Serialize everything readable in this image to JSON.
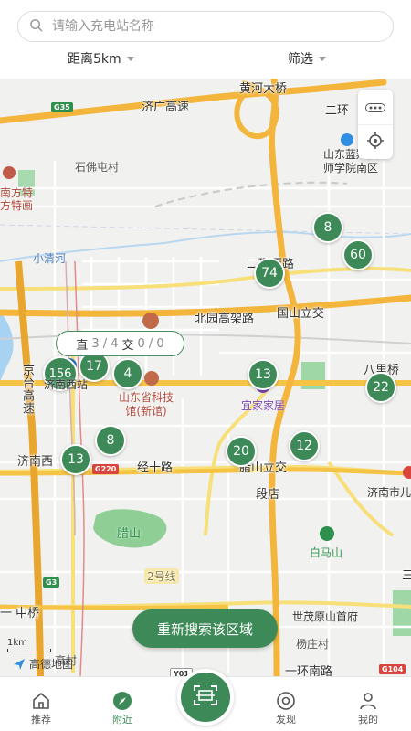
{
  "search": {
    "placeholder": "请输入充电站名称"
  },
  "filters": {
    "distance_label": "距离5km",
    "filter_label": "筛选"
  },
  "map": {
    "road_labels": {
      "jiguang": "济广高速",
      "huanghe_bridge": "黄河大桥",
      "erhuan_xilu": "二环西路",
      "beiyuan": "北园高架路",
      "guoshan_lijiao": "国山立交",
      "jingshi_road": "经十路",
      "lashan_lijiao": "腊山立交",
      "duandian": "段店",
      "jingtai": "京台高速",
      "yihuannan": "一环南路",
      "zhongqiao": "一 中桥",
      "erhuan_fragment": "二环",
      "jinan_west": "济南西",
      "sanshou": "三"
    },
    "shields": {
      "g35": "G35",
      "g220": "G220",
      "g3": "G3",
      "g104": "G104",
      "y01": "Y01",
      "line2": "2号线"
    },
    "pois": {
      "lanxiang": "山东蓝翔技\n师学院南区",
      "shifo": "石佛屯村",
      "nanfang": "南方特\n方特画",
      "xiaoqinghe": "小清河",
      "science_museum": "山东省科技\n馆(新馆)",
      "yijia": "宜家家居",
      "balqiao": "八里桥",
      "lashan": "腊山",
      "baimashan": "白马山",
      "jinan_city": "济南市儿",
      "shimao": "世茂原山首府",
      "yangzhuang": "杨庄村",
      "xi_station": "济南西站",
      "gaocun": "高村"
    },
    "markers": [
      {
        "count": "8"
      },
      {
        "count": "60"
      },
      {
        "count": "74"
      },
      {
        "count": "156"
      },
      {
        "count": "17"
      },
      {
        "count": "4"
      },
      {
        "count": "13"
      },
      {
        "count": "22"
      },
      {
        "count": "8"
      },
      {
        "count": "13"
      },
      {
        "count": "20"
      },
      {
        "count": "12"
      }
    ],
    "tooltip": {
      "zhi_label": "直",
      "zhi_value": "3 / 4",
      "jiao_label": "交",
      "jiao_value": "0 / 0"
    },
    "scale_label": "1km",
    "provider": "高德地图",
    "research_button": "重新搜索该区域"
  },
  "tabs": [
    {
      "label": "推荐",
      "icon": "home-icon"
    },
    {
      "label": "附近",
      "icon": "compass-icon",
      "active": true
    },
    {
      "label": "发现",
      "icon": "discover-icon"
    },
    {
      "label": "我的",
      "icon": "user-icon"
    }
  ],
  "colors": {
    "accent": "#3d8a58",
    "highway": "#f3c13f",
    "arterial": "#f7df7a"
  }
}
